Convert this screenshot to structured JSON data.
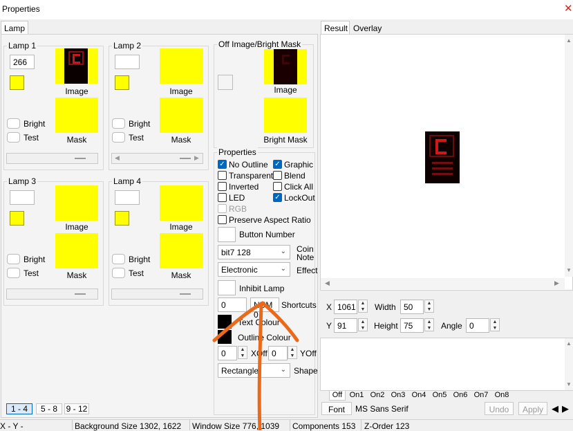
{
  "window": {
    "title": "Properties"
  },
  "left_tabs": [
    "Lamp"
  ],
  "lamps": [
    {
      "label": "Lamp 1",
      "value": "266",
      "image_label": "Image",
      "mask_label": "Mask",
      "bright_label": "Bright",
      "test_label": "Test"
    },
    {
      "label": "Lamp 2",
      "value": "",
      "image_label": "Image",
      "mask_label": "Mask",
      "bright_label": "Bright",
      "test_label": "Test"
    },
    {
      "label": "Lamp 3",
      "value": "",
      "image_label": "Image",
      "mask_label": "Mask",
      "bright_label": "Bright",
      "test_label": "Test"
    },
    {
      "label": "Lamp 4",
      "value": "",
      "image_label": "Image",
      "mask_label": "Mask",
      "bright_label": "Bright",
      "test_label": "Test"
    }
  ],
  "off_image": {
    "label": "Off Image/Bright Mask",
    "image_label": "Image",
    "mask_label": "Bright Mask"
  },
  "properties": {
    "label": "Properties",
    "checkboxes": [
      {
        "label": "No Outline",
        "checked": true
      },
      {
        "label": "Graphic",
        "checked": true
      },
      {
        "label": "Transparent",
        "checked": false
      },
      {
        "label": "Blend",
        "checked": false
      },
      {
        "label": "Inverted",
        "checked": false
      },
      {
        "label": "Click All",
        "checked": false
      },
      {
        "label": "LED",
        "checked": false
      },
      {
        "label": "LockOut",
        "checked": true
      },
      {
        "label": "RGB",
        "checked": false,
        "disabled": true
      },
      {
        "label": "Preserve Aspect Ratio",
        "checked": false
      }
    ],
    "button_number_label": "Button Number",
    "coin_select": "bit7 128",
    "coin_label_1": "Coin",
    "coin_label_2": "Note",
    "effect_select": "Electronic",
    "effect_label": "Effect",
    "inhibit_label": "Inhibit Lamp",
    "shortcut_value": "0",
    "num_value": "NUM 0",
    "shortcuts_label": "Shortcuts",
    "text_colour_label": "Text Colour",
    "outline_colour_label": "Outline Colour",
    "xoff_value": "0",
    "xoff_label": "XOff",
    "yoff_value": "0",
    "yoff_label": "YOff",
    "shape_select": "Rectangle",
    "shape_label": "Shape"
  },
  "page_buttons": [
    "1 - 4",
    "5 - 8",
    "9 - 12"
  ],
  "right_tabs": [
    "Result",
    "Overlay"
  ],
  "geometry": {
    "x_label": "X",
    "x_value": "1061",
    "y_label": "Y",
    "y_value": "91",
    "width_label": "Width",
    "width_value": "50",
    "height_label": "Height",
    "height_value": "75",
    "angle_label": "Angle",
    "angle_value": "0"
  },
  "state_tabs": [
    "Off",
    "On1",
    "On2",
    "On3",
    "On4",
    "On5",
    "On6",
    "On7",
    "On8"
  ],
  "font_button": "Font",
  "font_name": "MS Sans Serif",
  "undo_button": "Undo",
  "apply_button": "Apply",
  "status": {
    "xy": "X -   Y -",
    "background_size": "Background Size 1302, 1622",
    "window_size": "Window Size 776, 1039",
    "components": "Components 153",
    "z_order": "Z-Order 123"
  },
  "colors": {
    "accent": "#0067c0",
    "lamp_yellow": "#ffff00",
    "annotation": "#e86a1a"
  }
}
